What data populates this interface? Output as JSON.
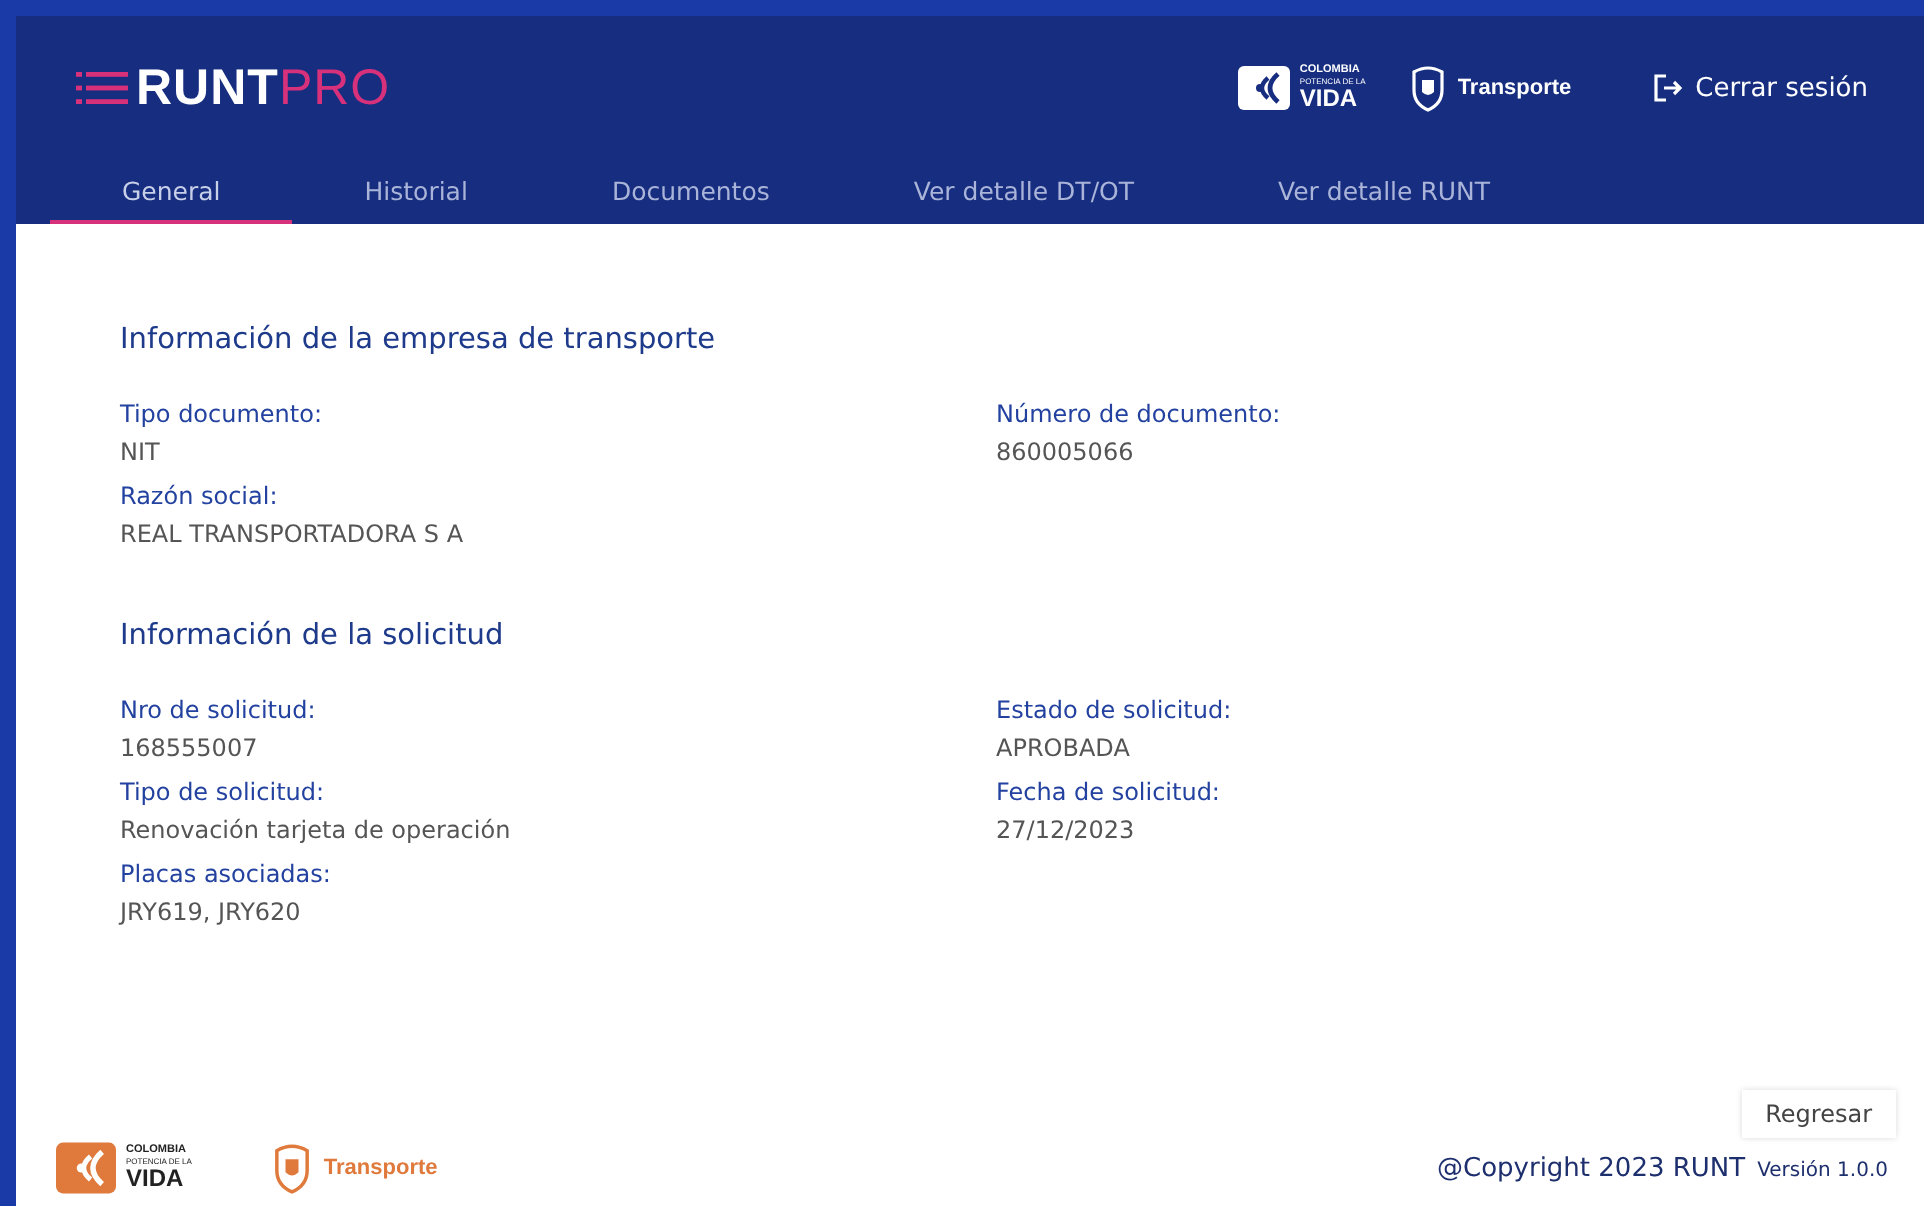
{
  "header": {
    "logo": {
      "main": "RUNT",
      "accent": "PRO"
    },
    "brand": {
      "line1": "COLOMBIA",
      "line2": "POTENCIA DE LA",
      "line3": "VIDA"
    },
    "ministry": "Transporte",
    "logout": "Cerrar sesión"
  },
  "tabs": [
    {
      "label": "General",
      "selected": true
    },
    {
      "label": "Historial",
      "selected": false
    },
    {
      "label": "Documentos",
      "selected": false
    },
    {
      "label": "Ver detalle DT/OT",
      "selected": false
    },
    {
      "label": "Ver detalle RUNT",
      "selected": false
    }
  ],
  "sections": [
    {
      "title": "Información de la empresa de transporte",
      "fields": [
        {
          "label": "Tipo documento:",
          "value": "NIT"
        },
        {
          "label": "Número de documento:",
          "value": "860005066"
        },
        {
          "label": "Razón social:",
          "value": "REAL TRANSPORTADORA S A"
        }
      ]
    },
    {
      "title": "Información de la solicitud",
      "fields": [
        {
          "label": "Nro de solicitud:",
          "value": "168555007"
        },
        {
          "label": "Estado de solicitud:",
          "value": "APROBADA"
        },
        {
          "label": "Tipo de solicitud:",
          "value": "Renovación tarjeta de operación"
        },
        {
          "label": "Fecha de solicitud:",
          "value": "27/12/2023"
        },
        {
          "label": "Placas asociadas:",
          "value": "JRY619, JRY620"
        }
      ]
    }
  ],
  "back_button": "Regresar",
  "footer": {
    "brand": {
      "line1": "COLOMBIA",
      "line2": "POTENCIA DE LA",
      "line3": "VIDA"
    },
    "ministry": "Transporte",
    "copyright": "@Copyright 2023 RUNT",
    "version": "Versión 1.0.0"
  }
}
